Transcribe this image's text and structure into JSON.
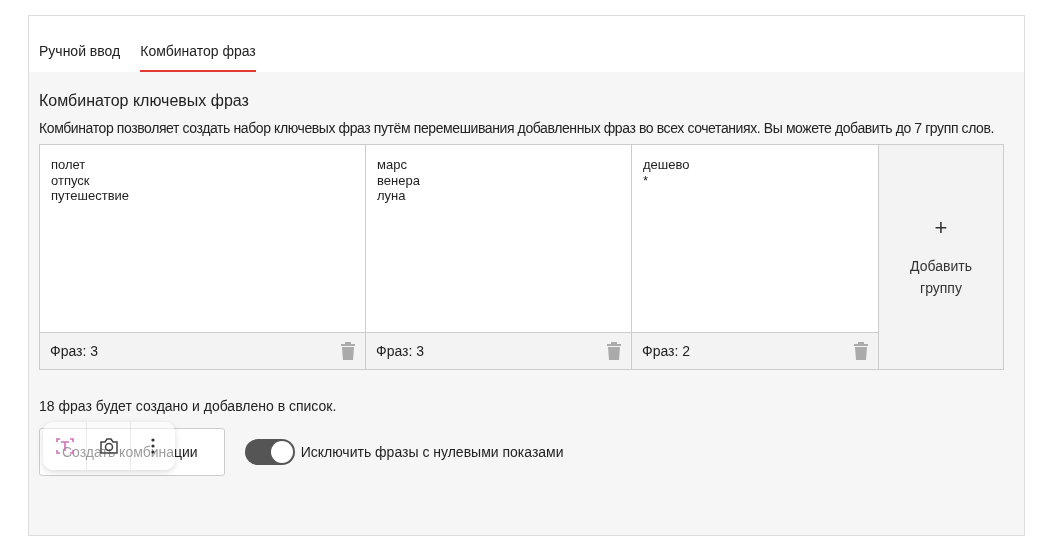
{
  "tabs": [
    {
      "label": "Ручной ввод",
      "selected": false
    },
    {
      "label": "Комбинатор фраз",
      "selected": true
    }
  ],
  "heading": "Комбинатор ключевых фраз",
  "description": "Комбинатор позволяет создать набор ключевых фраз путём перемешивания добавленных фраз во всех сочетаниях. Вы можете добавить до 7 групп слов.",
  "groups": [
    {
      "value": "полет\nотпуск\nпутешествие",
      "count": "Фраз: 3"
    },
    {
      "value": "марс\nвенера\nлуна",
      "count": "Фраз: 3"
    },
    {
      "value": "дешево\n*",
      "count": "Фраз: 2"
    }
  ],
  "add_group": {
    "icon": "+",
    "label": "Добавить группу"
  },
  "summary": "18 фраз будет создано и добавлено в список.",
  "create_button": "Создать комбинации",
  "exclude_toggle": {
    "label": "Исключить фразы с нулевыми показами",
    "on": true
  }
}
